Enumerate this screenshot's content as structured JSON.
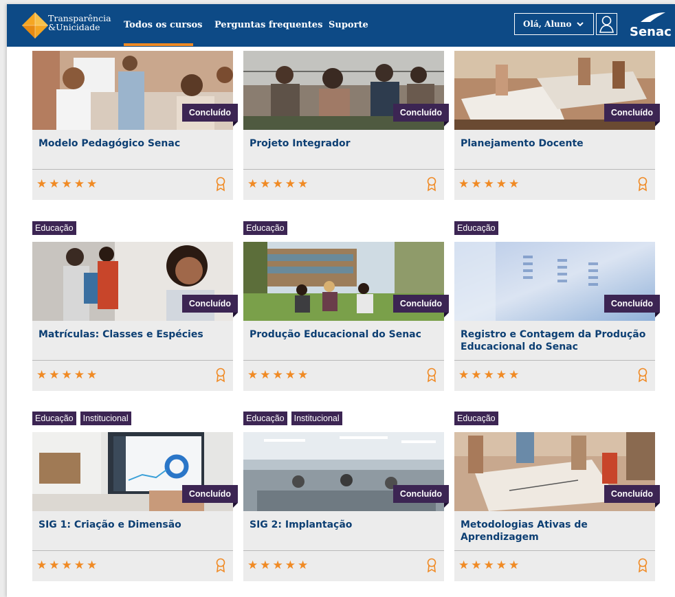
{
  "header": {
    "logo_line1": "Transparência",
    "logo_line2": "&Unicidade",
    "nav": [
      "Todos os cursos",
      "Perguntas frequentes",
      "Suporte"
    ],
    "greeting": "Olá, Aluno",
    "brand": "Senac",
    "colors": {
      "bar": "#0d4a86",
      "active": "#f08a24"
    }
  },
  "cards": [
    {
      "tags": [],
      "status": "Concluído",
      "title": "Modelo Pedagógico Senac",
      "stars": 5
    },
    {
      "tags": [],
      "status": "Concluído",
      "title": "Projeto Integrador",
      "stars": 5
    },
    {
      "tags": [],
      "status": "Concluído",
      "title": "Planejamento Docente",
      "stars": 5
    },
    {
      "tags": [
        "Educação"
      ],
      "status": "Concluído",
      "title": "Matrículas: Classes e Espécies",
      "stars": 5
    },
    {
      "tags": [
        "Educação"
      ],
      "status": "Concluído",
      "title": "Produção Educacional do Senac",
      "stars": 5
    },
    {
      "tags": [
        "Educação"
      ],
      "status": "Concluído",
      "title": "Registro e Contagem da Produção Educacional do Senac",
      "stars": 5
    },
    {
      "tags": [
        "Educação",
        "Institucional"
      ],
      "status": "Concluído",
      "title": "SIG 1: Criação e Dimensão",
      "stars": 5
    },
    {
      "tags": [
        "Educação",
        "Institucional"
      ],
      "status": "Concluído",
      "title": "SIG 2: Implantação",
      "stars": 5
    },
    {
      "tags": [
        "Educação"
      ],
      "status": "Concluído",
      "title": "Metodologias Ativas de Aprendizagem",
      "stars": 5
    }
  ],
  "colors": {
    "title": "#0d3f73",
    "badge": "#3c2553",
    "star": "#f08a24",
    "card": "#ececec"
  }
}
